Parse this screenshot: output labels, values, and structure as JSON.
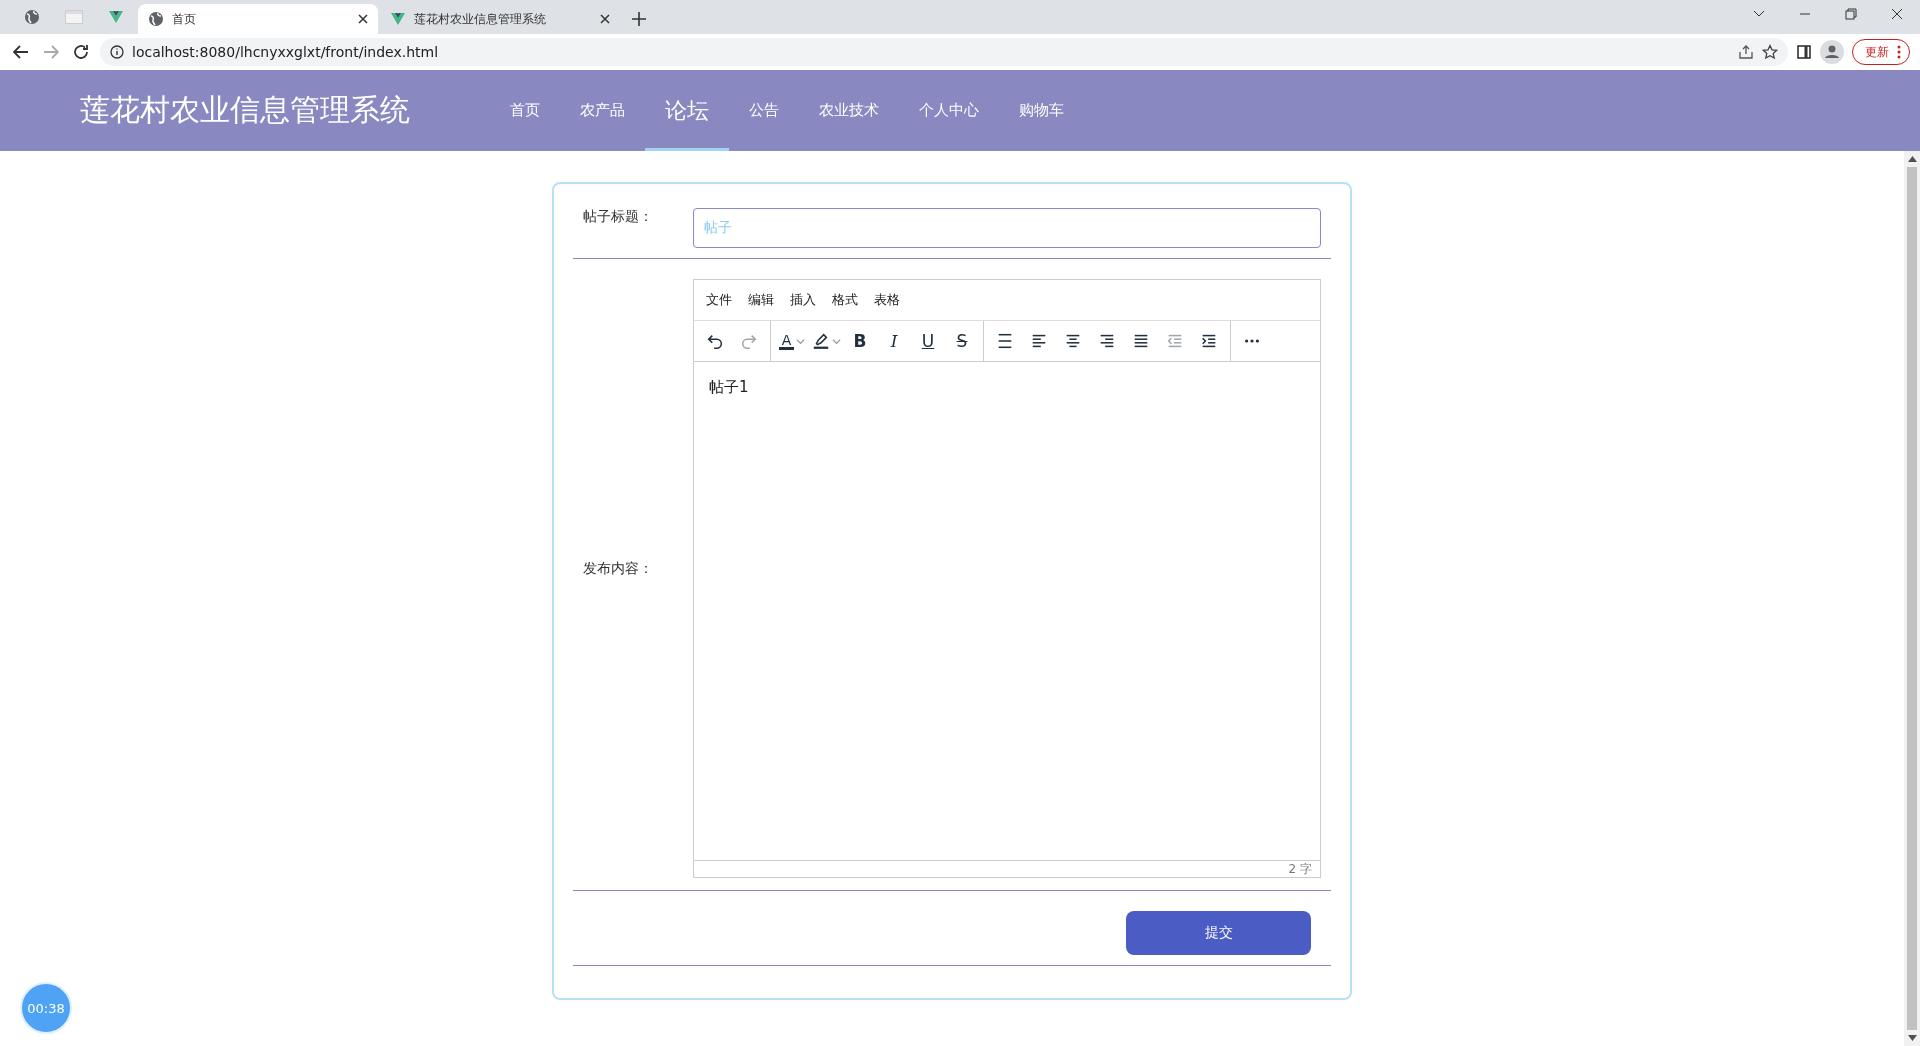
{
  "browser": {
    "tabs": [
      {
        "title": "首页",
        "selected": true,
        "kind": "globe"
      },
      {
        "title": "莲花村农业信息管理系统",
        "selected": false,
        "kind": "vue"
      }
    ],
    "url": "localhost:8080/lhcnyxxglxt/front/index.html",
    "update_button": "更新"
  },
  "header": {
    "title": "莲花村农业信息管理系统",
    "nav": [
      {
        "label": "首页",
        "selected": false
      },
      {
        "label": "农产品",
        "selected": false
      },
      {
        "label": "论坛",
        "selected": true
      },
      {
        "label": "公告",
        "selected": false
      },
      {
        "label": "农业技术",
        "selected": false
      },
      {
        "label": "个人中心",
        "selected": false
      },
      {
        "label": "购物车",
        "selected": false
      }
    ]
  },
  "form": {
    "title_label": "帖子标题：",
    "title_value": "帖子",
    "content_label": "发布内容：",
    "editor": {
      "menu": [
        "文件",
        "编辑",
        "插入",
        "格式",
        "表格"
      ],
      "toolbar": [
        [
          {
            "kind": "undo",
            "disabled": false
          },
          {
            "kind": "redo",
            "disabled": true
          }
        ],
        [
          {
            "kind": "text-color",
            "glyph": "A",
            "disabled": false
          },
          {
            "kind": "highlight",
            "disabled": false
          },
          {
            "kind": "bold",
            "glyph": "B",
            "disabled": false
          },
          {
            "kind": "italic",
            "glyph": "I",
            "disabled": false
          },
          {
            "kind": "underline",
            "glyph": "U",
            "disabled": false
          },
          {
            "kind": "strike",
            "glyph": "S",
            "disabled": false
          }
        ],
        [
          {
            "kind": "line-height",
            "disabled": false
          },
          {
            "kind": "align-left",
            "disabled": false
          },
          {
            "kind": "align-center",
            "disabled": false
          },
          {
            "kind": "align-right",
            "disabled": false
          },
          {
            "kind": "justify",
            "disabled": false
          },
          {
            "kind": "outdent",
            "disabled": true
          },
          {
            "kind": "indent",
            "disabled": false
          }
        ],
        [
          {
            "kind": "more",
            "disabled": false
          }
        ]
      ],
      "content": "帖子1",
      "word_count": "2 字"
    },
    "submit": "提交"
  },
  "timer": "00:38"
}
